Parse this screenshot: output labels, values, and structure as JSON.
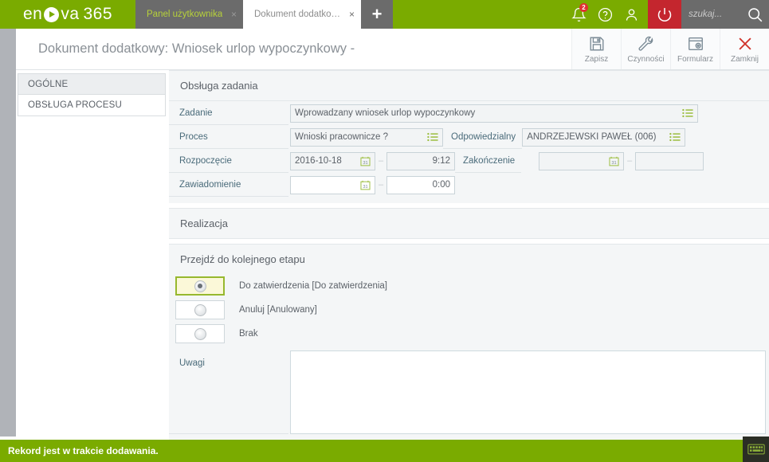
{
  "app": {
    "brand": "enova",
    "brand_suffix": "365",
    "search_placeholder": "szukaj...",
    "notification_count": "2"
  },
  "tabs": [
    {
      "label": "Panel użytkownika",
      "active": false,
      "close": "×"
    },
    {
      "label": "Dokument dodatkowy...",
      "active": true,
      "close": "×"
    }
  ],
  "tab_new_label": "+",
  "document": {
    "title": "Dokument dodatkowy: Wniosek urlop wypoczynkowy -"
  },
  "toolbar": [
    {
      "label": "Zapisz",
      "icon": "save-icon"
    },
    {
      "label": "Czynności",
      "icon": "wrench-icon"
    },
    {
      "label": "Formularz",
      "icon": "form-icon"
    },
    {
      "label": "Zamknij",
      "icon": "close-x-icon"
    }
  ],
  "sidebar": {
    "header": "OGÓLNE",
    "items": [
      {
        "label": "OBSŁUGA PROCESU"
      }
    ]
  },
  "sections": {
    "task": {
      "title": "Obsługa zadania",
      "fields": {
        "zadanie_label": "Zadanie",
        "zadanie_value": "Wprowadzany wniosek urlop wypoczynkowy",
        "proces_label": "Proces",
        "proces_value": "Wnioski pracownicze ?",
        "odpowiedzialny_label": "Odpowiedzialny",
        "odpowiedzialny_value": "ANDRZEJEWSKI PAWEŁ (006)",
        "rozpoczecie_label": "Rozpoczęcie",
        "rozpoczecie_date": "2016-10-18",
        "rozpoczecie_time": "9:12",
        "zakonczenie_label": "Zakończenie",
        "zakonczenie_date": "",
        "zakonczenie_time": "",
        "zawiadomienie_label": "Zawiadomienie",
        "zawiadomienie_date": "",
        "zawiadomienie_time": "0:00"
      }
    },
    "realizacja": {
      "title": "Realizacja"
    },
    "next_stage": {
      "title": "Przejdź do kolejnego etapu",
      "options": [
        {
          "label": "Do zatwierdzenia [Do zatwierdzenia]",
          "selected": true
        },
        {
          "label": "Anuluj [Anulowany]",
          "selected": false
        },
        {
          "label": "Brak",
          "selected": false
        }
      ],
      "uwagi_label": "Uwagi",
      "uwagi_value": "",
      "uwagi_placeholder": ""
    }
  },
  "statusbar": {
    "message": "Rekord jest w trakcie dodawania.",
    "keyboard_icon": "keyboard-icon"
  },
  "colors": {
    "brand_green": "#7aab00",
    "power_red": "#c4262e",
    "tab_gray": "#6b6b6b",
    "accent_olive": "#97b82e",
    "label_blue": "#4a6b7a"
  }
}
